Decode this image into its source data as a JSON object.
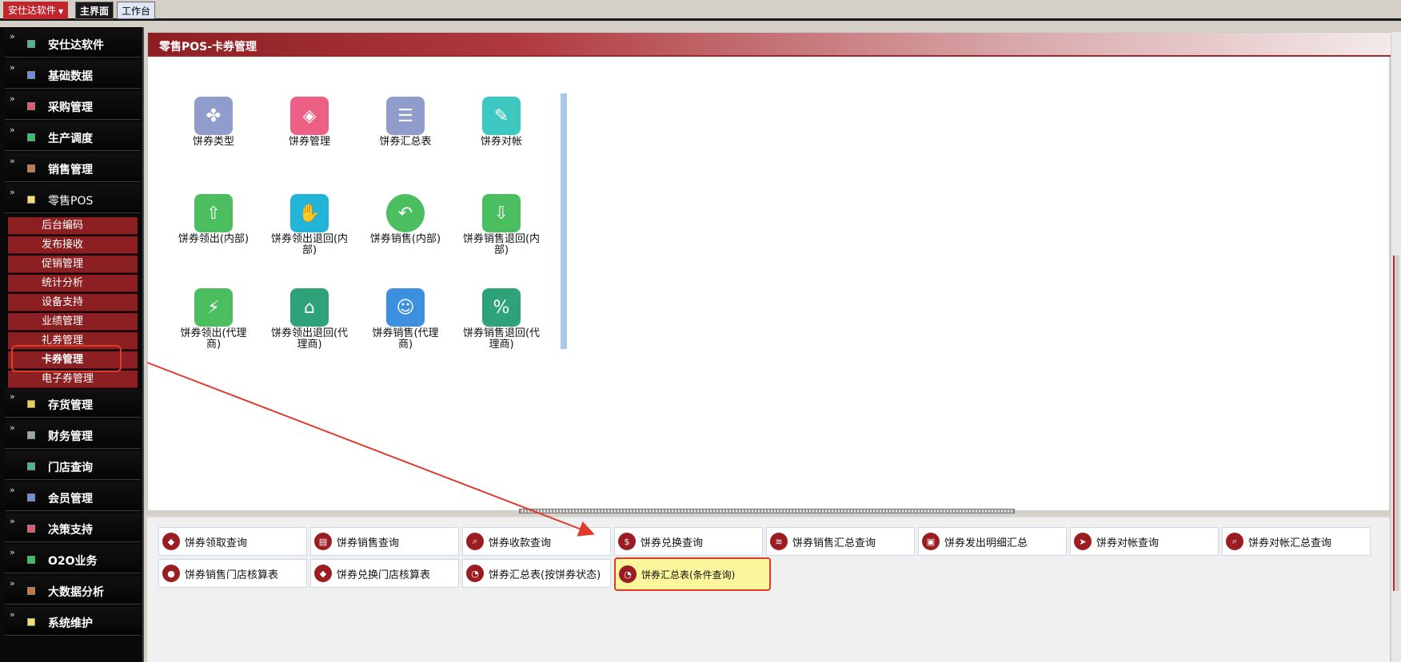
{
  "topbar": {
    "brand": "安仕达软件",
    "tabs": [
      {
        "label": "主界面"
      },
      {
        "label": "工作台"
      }
    ]
  },
  "sidebar": {
    "items": [
      {
        "label": "安仕达软件",
        "color": "#4bb39b"
      },
      {
        "label": "基础数据",
        "color": "#6e8fe0"
      },
      {
        "label": "采购管理",
        "color": "#e8546b"
      },
      {
        "label": "生产调度",
        "color": "#2fc46a"
      },
      {
        "label": "销售管理",
        "color": "#c87840"
      },
      {
        "label": "零售POS",
        "color": "#f2e06a"
      }
    ],
    "sub_items": [
      {
        "label": "后台编码"
      },
      {
        "label": "发布接收"
      },
      {
        "label": "促销管理"
      },
      {
        "label": "统计分析"
      },
      {
        "label": "设备支持"
      },
      {
        "label": "业绩管理"
      },
      {
        "label": "礼券管理"
      },
      {
        "label": "卡券管理"
      },
      {
        "label": "电子券管理"
      }
    ],
    "items_after": [
      {
        "label": "存货管理",
        "color": "#e8d04a"
      },
      {
        "label": "财务管理",
        "color": "#9aa"
      },
      {
        "label": "门店查询",
        "color": "#4bb39b"
      },
      {
        "label": "会员管理",
        "color": "#6e8fe0"
      },
      {
        "label": "决策支持",
        "color": "#e8546b"
      },
      {
        "label": "O2O业务",
        "color": "#2fc46a"
      },
      {
        "label": "大数据分析",
        "color": "#c87840"
      },
      {
        "label": "系统维护",
        "color": "#f2e06a"
      }
    ]
  },
  "main": {
    "title": "零售POS-卡券管理",
    "tiles": [
      {
        "label": "饼券类型",
        "color": "#8f9ccc",
        "icon": "grid-icon",
        "glyph": "✤"
      },
      {
        "label": "饼券管理",
        "color": "#ee5f86",
        "icon": "tag-icon",
        "glyph": "◈"
      },
      {
        "label": "饼券汇总表",
        "color": "#8f9ccc",
        "icon": "server-icon",
        "glyph": "☰"
      },
      {
        "label": "饼券对帐",
        "color": "#3cc7c0",
        "icon": "pin-icon",
        "glyph": "✎"
      },
      {
        "label": "饼券领出(内部)",
        "color": "#4bbf5f",
        "icon": "folder-up-icon",
        "glyph": "⇧"
      },
      {
        "label": "饼券领出退回(内部)",
        "color": "#22b5d8",
        "icon": "hand-card-icon",
        "glyph": "✋"
      },
      {
        "label": "饼券销售(内部)",
        "color": "#4bbf5f",
        "icon": "undo-icon",
        "glyph": "↶"
      },
      {
        "label": "饼券销售退回(内部)",
        "color": "#4bbf5f",
        "icon": "folder-down-icon",
        "glyph": "⇩"
      },
      {
        "label": "饼券领出(代理商)",
        "color": "#4bbf5f",
        "icon": "folder-bolt-icon",
        "glyph": "⚡"
      },
      {
        "label": "饼券领出退回(代理商)",
        "color": "#2ea37a",
        "icon": "house-chart-icon",
        "glyph": "⌂"
      },
      {
        "label": "饼券销售(代理商)",
        "color": "#3d8fe0",
        "icon": "users-icon",
        "glyph": "☺"
      },
      {
        "label": "饼券销售退回(代理商)",
        "color": "#2ea37a",
        "icon": "percent-badge-icon",
        "glyph": "%"
      }
    ]
  },
  "bottom": {
    "buttons": [
      {
        "label": "饼券领取查询",
        "icon": "tag-icon",
        "glyph": "◆"
      },
      {
        "label": "饼券销售查询",
        "icon": "clipboard-icon",
        "glyph": "▤"
      },
      {
        "label": "饼券收款查询",
        "icon": "search-icon",
        "glyph": "⌕"
      },
      {
        "label": "饼券兑换查询",
        "icon": "dollar-icon",
        "glyph": "$"
      },
      {
        "label": "饼券销售汇总查询",
        "icon": "layers-icon",
        "glyph": "≋"
      },
      {
        "label": "饼券发出明细汇总",
        "icon": "id-card-icon",
        "glyph": "▣"
      },
      {
        "label": "饼券对帐查询",
        "icon": "send-icon",
        "glyph": "➤"
      },
      {
        "label": "饼券对帐汇总查询",
        "icon": "search-icon",
        "glyph": "⌕"
      },
      {
        "label": "饼券销售门店核算表",
        "icon": "user-icon",
        "glyph": "●"
      },
      {
        "label": "饼券兑换门店核算表",
        "icon": "tag-icon",
        "glyph": "◆"
      },
      {
        "label": "饼券汇总表(按饼券状态)",
        "icon": "pie-icon",
        "glyph": "◔"
      },
      {
        "label": "饼券汇总表(条件查询)",
        "icon": "pie-icon",
        "glyph": "◔"
      }
    ]
  }
}
